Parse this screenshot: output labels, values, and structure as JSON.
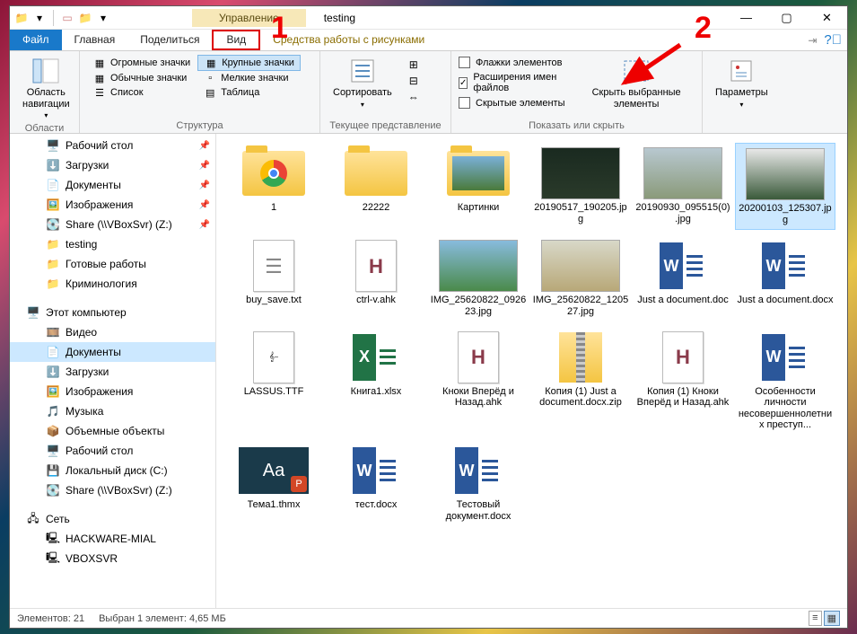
{
  "window": {
    "title": "testing",
    "context_tab": "Управление",
    "context_sub": "Средства работы с рисунками"
  },
  "tabs": {
    "file": "Файл",
    "home": "Главная",
    "share": "Поделиться",
    "view": "Вид"
  },
  "ribbon": {
    "panes_group": "Области",
    "nav_pane": "Область навигации",
    "layout_group": "Структура",
    "layouts": {
      "huge": "Огромные значки",
      "large": "Крупные значки",
      "normal": "Обычные значки",
      "small": "Мелкие значки",
      "list": "Список",
      "table": "Таблица"
    },
    "currview_group": "Текущее представление",
    "sort": "Сортировать",
    "showhide_group": "Показать или скрыть",
    "chk_itemboxes": "Флажки элементов",
    "chk_ext": "Расширения имен файлов",
    "chk_hidden": "Скрытые элементы",
    "hide_selected": "Скрыть выбранные элементы",
    "options": "Параметры"
  },
  "nav": {
    "quick": [
      {
        "label": "Рабочий стол",
        "icon": "desktop",
        "pin": true
      },
      {
        "label": "Загрузки",
        "icon": "down",
        "pin": true
      },
      {
        "label": "Документы",
        "icon": "doc",
        "pin": true
      },
      {
        "label": "Изображения",
        "icon": "pic",
        "pin": true
      },
      {
        "label": "Share (\\\\VBoxSvr) (Z:)",
        "icon": "drive",
        "pin": true
      },
      {
        "label": "testing",
        "icon": "folder"
      },
      {
        "label": "Готовые работы",
        "icon": "folder"
      },
      {
        "label": "Криминология",
        "icon": "folder"
      }
    ],
    "thispc_label": "Этот компьютер",
    "thispc": [
      {
        "label": "Видео",
        "icon": "video"
      },
      {
        "label": "Документы",
        "icon": "doc",
        "selected": true
      },
      {
        "label": "Загрузки",
        "icon": "down"
      },
      {
        "label": "Изображения",
        "icon": "pic"
      },
      {
        "label": "Музыка",
        "icon": "music"
      },
      {
        "label": "Объемные объекты",
        "icon": "cube"
      },
      {
        "label": "Рабочий стол",
        "icon": "desktop"
      },
      {
        "label": "Локальный диск (C:)",
        "icon": "disk"
      },
      {
        "label": "Share (\\\\VBoxSvr) (Z:)",
        "icon": "drive"
      }
    ],
    "network_label": "Сеть",
    "network": [
      {
        "label": "HACKWARE-MIAL",
        "icon": "pc"
      },
      {
        "label": "VBOXSVR",
        "icon": "pc"
      }
    ]
  },
  "files": [
    {
      "name": "1",
      "kind": "folder-chrome"
    },
    {
      "name": "22222",
      "kind": "folder"
    },
    {
      "name": "Картинки",
      "kind": "folder-photo"
    },
    {
      "name": "20190517_190205.jpg",
      "kind": "photo",
      "bg": "linear-gradient(#1a2a20,#2a3a2a)"
    },
    {
      "name": "20190930_095515(0).jpg",
      "kind": "photo",
      "bg": "linear-gradient(#b8c8d0,#8a9a7a)"
    },
    {
      "name": "20200103_125307.jpg",
      "kind": "photo",
      "bg": "linear-gradient(#e8e8e8,#3a5a3a)",
      "selected": true
    },
    {
      "name": "buy_save.txt",
      "kind": "txt"
    },
    {
      "name": "ctrl-v.ahk",
      "kind": "ahk"
    },
    {
      "name": "IMG_25620822_092623.jpg",
      "kind": "photo",
      "bg": "linear-gradient(#88bbdd,#4a8a4a)"
    },
    {
      "name": "IMG_25620822_120527.jpg",
      "kind": "photo",
      "bg": "linear-gradient(#d8d8c8,#b8a878)"
    },
    {
      "name": "Just a document.doc",
      "kind": "word"
    },
    {
      "name": "Just a document.docx",
      "kind": "word"
    },
    {
      "name": "LASSUS.TTF",
      "kind": "font"
    },
    {
      "name": "Книга1.xlsx",
      "kind": "excel"
    },
    {
      "name": "Кноки Вперёд и Назад.ahk",
      "kind": "ahk"
    },
    {
      "name": "Копия (1) Just a document.docx.zip",
      "kind": "zip"
    },
    {
      "name": "Копия (1) Кноки Вперёд и Назад.ahk",
      "kind": "ahk"
    },
    {
      "name": "Особенности личности несовершеннолетних преступ...",
      "kind": "word"
    },
    {
      "name": "Тема1.thmx",
      "kind": "thmx"
    },
    {
      "name": "тест.docx",
      "kind": "word"
    },
    {
      "name": "Тестовый документ.docx",
      "kind": "word"
    }
  ],
  "status": {
    "count_label": "Элементов: 21",
    "selection_label": "Выбран 1 элемент: 4,65 МБ"
  },
  "annotations": {
    "one": "1",
    "two": "2"
  }
}
